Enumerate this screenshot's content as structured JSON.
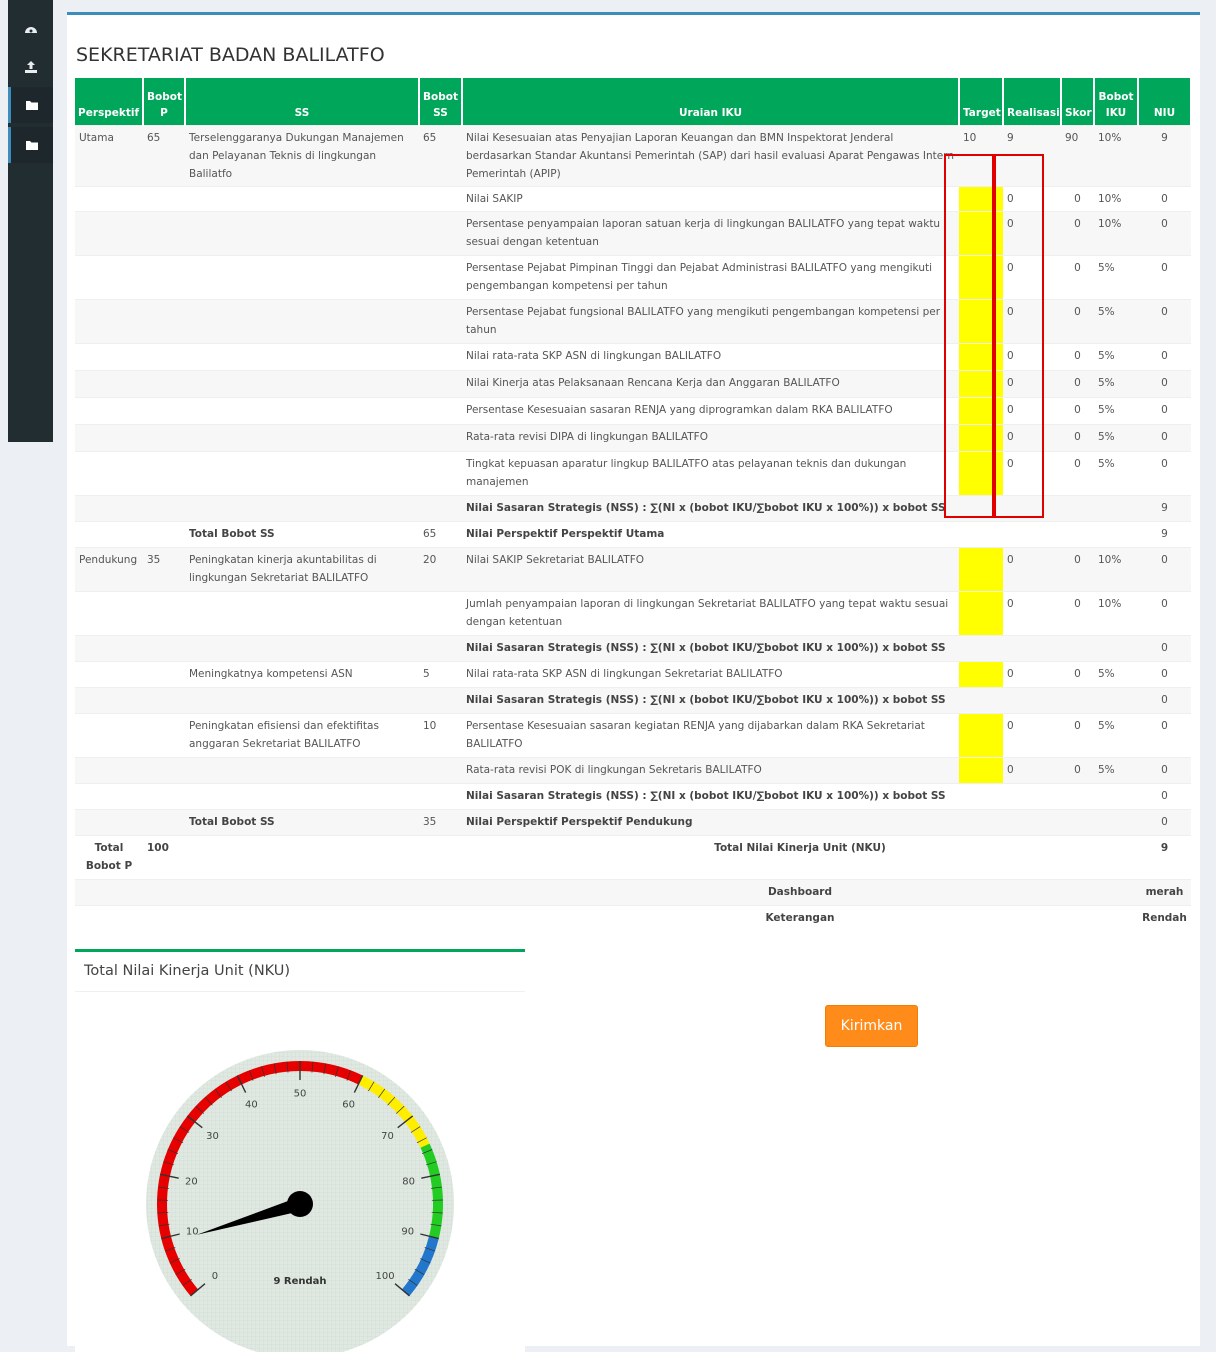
{
  "page": {
    "title": "SEKRETARIAT BADAN BALILATFO"
  },
  "table": {
    "headers": {
      "perspektif": "Perspektif",
      "bobot_p": "Bobot P",
      "ss": "SS",
      "bobot_ss": "Bobot SS",
      "uraian": "Uraian IKU",
      "target": "Target",
      "realisasi": "Realisasi",
      "skor": "Skor",
      "bobot_iku": "Bobot IKU",
      "niu": "NIU"
    },
    "rows": [
      {
        "perspektif": "Utama",
        "bobot_p": "65",
        "ss": "Terselenggaranya Dukungan Manajemen dan Pelayanan Teknis di lingkungan Balilatfo",
        "bobot_ss": "65",
        "uraian": "Nilai Kesesuaian atas Penyajian Laporan Keuangan dan BMN Inspektorat Jenderal berdasarkan Standar Akuntansi Pemerintah (SAP) dari hasil evaluasi Aparat Pengawas Intern Pemerintah (APIP)",
        "target": "10",
        "realisasi": "9",
        "skor": "90",
        "bobot_iku": "10%",
        "niu": "9"
      },
      {
        "uraian": "Nilai SAKIP",
        "realisasi": "0",
        "skor": "0",
        "bobot_iku": "10%",
        "niu": "0"
      },
      {
        "uraian": "Persentase penyampaian laporan satuan kerja di lingkungan BALILATFO yang tepat waktu sesuai dengan ketentuan",
        "realisasi": "0",
        "skor": "0",
        "bobot_iku": "10%",
        "niu": "0"
      },
      {
        "uraian": "Persentase Pejabat Pimpinan Tinggi dan Pejabat Administrasi BALILATFO yang mengikuti pengembangan kompetensi per tahun",
        "realisasi": "0",
        "skor": "0",
        "bobot_iku": "5%",
        "niu": "0"
      },
      {
        "uraian": "Persentase Pejabat fungsional BALILATFO yang mengikuti pengembangan kompetensi per tahun",
        "realisasi": "0",
        "skor": "0",
        "bobot_iku": "5%",
        "niu": "0"
      },
      {
        "uraian": "Nilai rata-rata SKP ASN di lingkungan BALILATFO",
        "realisasi": "0",
        "skor": "0",
        "bobot_iku": "5%",
        "niu": "0"
      },
      {
        "uraian": "Nilai Kinerja atas Pelaksanaan Rencana Kerja dan Anggaran BALILATFO",
        "realisasi": "0",
        "skor": "0",
        "bobot_iku": "5%",
        "niu": "0"
      },
      {
        "uraian": "Persentase Kesesuaian sasaran RENJA yang diprogramkan dalam RKA BALILATFO",
        "realisasi": "0",
        "skor": "0",
        "bobot_iku": "5%",
        "niu": "0"
      },
      {
        "uraian": "Rata-rata revisi DIPA di lingkungan BALILATFO",
        "realisasi": "0",
        "skor": "0",
        "bobot_iku": "5%",
        "niu": "0"
      },
      {
        "uraian": "Tingkat kepuasan aparatur lingkup BALILATFO atas pelayanan teknis dan dukungan manajemen",
        "realisasi": "0",
        "skor": "0",
        "bobot_iku": "5%",
        "niu": "0"
      },
      {
        "uraian": "Nilai Sasaran Strategis (NSS) : ∑(NI x (bobot IKU/∑bobot IKU x 100%)) x bobot SS",
        "niu": "9"
      },
      {
        "ss": "Total Bobot SS",
        "bobot_ss": "65",
        "uraian": "Nilai Perspektif Perspektif Utama",
        "niu": "9"
      },
      {
        "perspektif": "Pendukung",
        "bobot_p": "35",
        "ss": "Peningkatan kinerja akuntabilitas di lingkungan Sekretariat BALILATFO",
        "bobot_ss": "20",
        "uraian": "Nilai SAKIP Sekretariat BALILATFO",
        "realisasi": "0",
        "skor": "0",
        "bobot_iku": "10%",
        "niu": "0"
      },
      {
        "uraian": "Jumlah penyampaian laporan di lingkungan Sekretariat BALILATFO yang tepat waktu sesuai dengan ketentuan",
        "realisasi": "0",
        "skor": "0",
        "bobot_iku": "10%",
        "niu": "0"
      },
      {
        "uraian": "Nilai Sasaran Strategis (NSS) : ∑(NI x (bobot IKU/∑bobot IKU x 100%)) x bobot SS",
        "niu": "0"
      },
      {
        "ss": "Meningkatnya kompetensi ASN",
        "bobot_ss": "5",
        "uraian": "Nilai rata-rata SKP ASN di lingkungan Sekretariat BALILATFO",
        "realisasi": "0",
        "skor": "0",
        "bobot_iku": "5%",
        "niu": "0"
      },
      {
        "uraian": "Nilai Sasaran Strategis (NSS) : ∑(NI x (bobot IKU/∑bobot IKU x 100%)) x bobot SS",
        "niu": "0"
      },
      {
        "ss": "Peningkatan efisiensi dan efektifitas anggaran Sekretariat BALILATFO",
        "bobot_ss": "10",
        "uraian": "Persentase Kesesuaian sasaran kegiatan RENJA yang dijabarkan dalam RKA Sekretariat BALILATFO",
        "realisasi": "0",
        "skor": "0",
        "bobot_iku": "5%",
        "niu": "0"
      },
      {
        "uraian": "Rata-rata revisi POK di lingkungan Sekretaris BALILATFO",
        "realisasi": "0",
        "skor": "0",
        "bobot_iku": "5%",
        "niu": "0"
      },
      {
        "uraian": "Nilai Sasaran Strategis (NSS) : ∑(NI x (bobot IKU/∑bobot IKU x 100%)) x bobot SS",
        "niu": "0"
      },
      {
        "ss": "Total Bobot SS",
        "bobot_ss": "35",
        "uraian": "Nilai Perspektif Perspektif Pendukung",
        "niu": "0"
      }
    ],
    "summary": {
      "total_bobot_p_label": "Total Bobot P",
      "total_bobot_p_value": "100",
      "nku_label": "Total Nilai Kinerja Unit (NKU)",
      "nku_value": "9",
      "dashboard_label": "Dashboard",
      "dashboard_value": "merah",
      "keterangan_label": "Keterangan",
      "keterangan_value": "Rendah"
    }
  },
  "gauge": {
    "title": "Total Nilai Kinerja Unit (NKU)",
    "value": 9,
    "min": 0,
    "max": 100,
    "ticks": [
      "0",
      "10",
      "20",
      "30",
      "40",
      "50",
      "60",
      "70",
      "80",
      "90",
      "100"
    ],
    "readout": "9 Rendah",
    "bands": [
      {
        "from": 0,
        "to": 60,
        "color": "#e60000"
      },
      {
        "from": 60,
        "to": 75,
        "color": "#ffee00"
      },
      {
        "from": 75,
        "to": 90,
        "color": "#22cc22"
      },
      {
        "from": 90,
        "to": 100,
        "color": "#2277cc"
      }
    ]
  },
  "actions": {
    "submit_label": "Kirimkan"
  },
  "colors": {
    "header_green": "#00a65a",
    "highlight_yellow": "#ffff00",
    "submit_orange": "#ff8c1a"
  }
}
